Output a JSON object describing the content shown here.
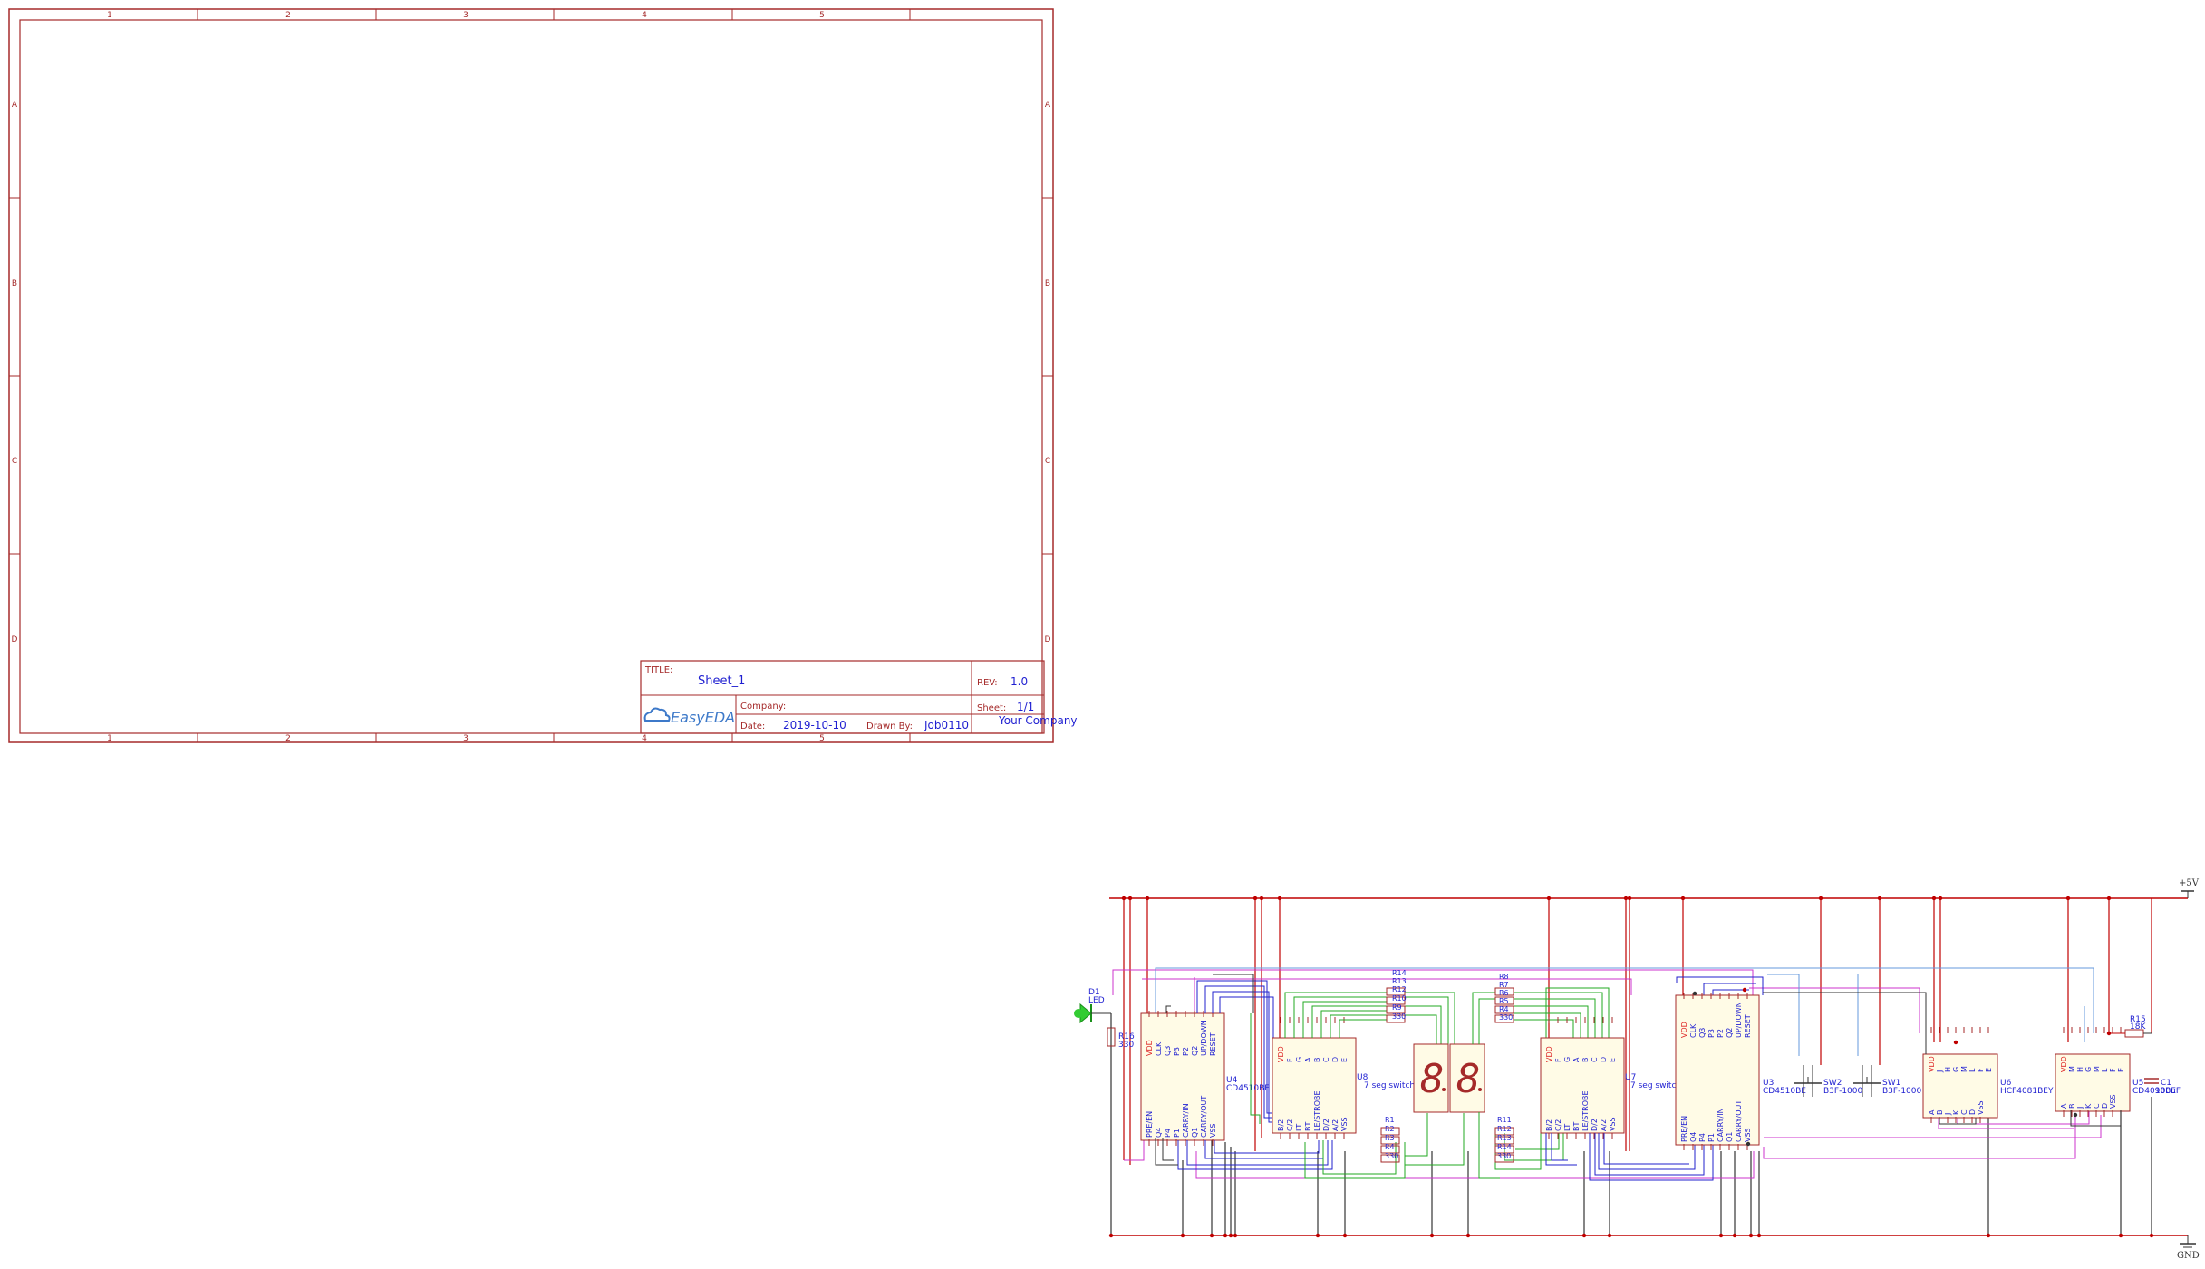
{
  "frame": {
    "columns": [
      "1",
      "2",
      "3",
      "4",
      "5"
    ],
    "rows": [
      "A",
      "B",
      "C",
      "D"
    ]
  },
  "title_block": {
    "title_label": "TITLE:",
    "title_value": "Sheet_1",
    "rev_label": "REV:",
    "rev_value": "1.0",
    "company_label": "Company:",
    "company_value": "Your Company",
    "sheet_label": "Sheet:",
    "sheet_value": "1/1",
    "date_label": "Date:",
    "date_value": "2019-10-10",
    "drawn_label": "Drawn By:",
    "drawn_value": "Job0110",
    "logo_text": "EasyEDA"
  },
  "power": {
    "vcc": "+5V",
    "gnd": "GND"
  },
  "components": {
    "d1": {
      "ref": "D1",
      "value": "LED"
    },
    "r16": {
      "ref": "R16",
      "value": "330"
    },
    "u4": {
      "ref": "U4",
      "value": "CD4510BE",
      "pins_top": [
        "VDD",
        "CLK",
        "Q3",
        "P3",
        "P2",
        "Q2",
        "UP/DOWN",
        "RESET"
      ],
      "pins_bottom": [
        "PRE/EN",
        "Q4",
        "P4",
        "P1",
        "CARRY/IN",
        "Q1",
        "CARRY/OUT",
        "VSS"
      ]
    },
    "u8": {
      "ref": "U8",
      "value": "7 seg switch",
      "pins_top": [
        "VDD",
        "F",
        "G",
        "A",
        "B",
        "C",
        "D",
        "E"
      ],
      "pins_bottom": [
        "B/2",
        "C/2",
        "LT",
        "BT",
        "LE/STROBE",
        "D/2",
        "A/2",
        "VSS"
      ]
    },
    "u7": {
      "ref": "U7",
      "value": "7 seg switch",
      "pins_top": [
        "VDD",
        "F",
        "G",
        "A",
        "B",
        "C",
        "D",
        "E"
      ],
      "pins_bottom": [
        "B/2",
        "C/2",
        "LT",
        "BT",
        "LE/STROBE",
        "D/2",
        "A/2",
        "VSS"
      ]
    },
    "u3": {
      "ref": "U3",
      "value": "CD4510BE",
      "pins_top": [
        "VDD",
        "CLK",
        "Q3",
        "P3",
        "P2",
        "Q2",
        "UP/DOWN",
        "RESET"
      ],
      "pins_bottom": [
        "PRE/EN",
        "Q4",
        "P4",
        "P1",
        "CARRY/IN",
        "Q1",
        "CARRY/OUT",
        "VSS"
      ]
    },
    "sw2": {
      "ref": "SW2",
      "value": "B3F-1000"
    },
    "sw1": {
      "ref": "SW1",
      "value": "B3F-1000"
    },
    "u6": {
      "ref": "U6",
      "value": "HCF4081BEY",
      "pins_top": [
        "VDD",
        "J",
        "H",
        "G",
        "M",
        "L",
        "F",
        "E"
      ],
      "pins_bottom": [
        "A",
        "B",
        "J",
        "K",
        "C",
        "D",
        "VSS"
      ]
    },
    "u5": {
      "ref": "U5",
      "value": "CD4093BE",
      "pins_top": [
        "VDD",
        "M",
        "H",
        "G",
        "M",
        "L",
        "F",
        "E"
      ],
      "pins_bottom": [
        "A",
        "B",
        "J",
        "K",
        "C",
        "D",
        "VSS"
      ]
    },
    "r15": {
      "ref": "R15",
      "value": "18K"
    },
    "c1": {
      "ref": "C1",
      "value": "100uF"
    },
    "left_res_top": [
      "R14",
      "R13",
      "R12",
      "R10",
      "R9",
      "330"
    ],
    "left_res_bottom": [
      "R1",
      "R2",
      "R3",
      "R4",
      "330"
    ],
    "right_res_top": [
      "R8",
      "R7",
      "R6",
      "R5",
      "R4",
      "330"
    ],
    "right_res_bottom": [
      "R11",
      "R12",
      "R13",
      "R14",
      "330"
    ]
  }
}
